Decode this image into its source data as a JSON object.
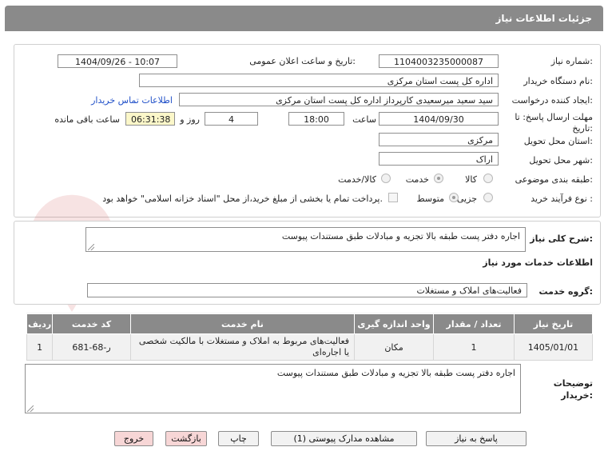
{
  "header": {
    "title": "جزئیات اطلاعات نیاز"
  },
  "form": {
    "need_number": {
      "label": "شماره نیاز:",
      "value": "1104003235000087"
    },
    "announce": {
      "label": "تاریخ و ساعت اعلان عمومی:",
      "value": "1404/09/26 - 10:07"
    },
    "buyer_org": {
      "label": "نام دستگاه خریدار:",
      "value": "اداره کل پست استان مرکزی"
    },
    "requester": {
      "label": "ایجاد کننده درخواست:",
      "value": "سید سعید میرسعیدی کارپرداز اداره کل پست استان مرکزی",
      "contact_link": "اطلاعات تماس خریدار"
    },
    "deadline": {
      "label_line1": "مهلت ارسال پاسخ: تا",
      "label_line2": "تاریخ:",
      "date": "1404/09/30",
      "time_label": "ساعت",
      "time": "18:00",
      "days": "4",
      "days_label": "روز و",
      "remaining": "06:31:38",
      "remaining_label": "ساعت باقی مانده"
    },
    "province": {
      "label": "استان محل تحویل:",
      "value": "مرکزی"
    },
    "city": {
      "label": "شهر محل تحویل:",
      "value": "اراک"
    },
    "category": {
      "label": "طبقه بندی موضوعی:",
      "options": [
        "کالا",
        "خدمت",
        "کالا/خدمت"
      ],
      "selected": "خدمت"
    },
    "purchase_type": {
      "label": "نوع فرآیند خرید :",
      "options": [
        "جزیی",
        "متوسط"
      ],
      "selected": "متوسط",
      "note": "پرداخت تمام یا بخشی از مبلغ خرید،از محل \"اسناد خزانه اسلامی\" خواهد بود."
    }
  },
  "description": {
    "label": "شرح کلی نیاز:",
    "value": "اجاره دفتر پست طبقه بالا تجزیه و مبادلات طبق مستندات پیوست"
  },
  "services": {
    "section_title": "اطلاعات خدمات مورد نیاز",
    "group_label": "گروه خدمت:",
    "group_value": "فعالیت‌های  املاک و مستغلات",
    "columns": [
      "ردیف",
      "کد خدمت",
      "نام خدمت",
      "واحد اندازه گیری",
      "تعداد / مقدار",
      "تاریخ نیاز"
    ],
    "rows": [
      {
        "row": "1",
        "code": "ر-68-681",
        "name": "فعالیت‌های مربوط به املاک و مستغلات با مالکیت شخصی یا اجاره‌ای",
        "unit": "مکان",
        "qty": "1",
        "date": "1405/01/01"
      }
    ]
  },
  "buyer_notes": {
    "label_line1": "توضیحات",
    "label_line2": "خریدار:",
    "value": "اجاره دفتر پست طبقه بالا تجزیه و مبادلات طبق مستندات پیوست"
  },
  "buttons": {
    "respond": "پاسخ به نیاز",
    "view_docs": "مشاهده مدارک پیوستی (1)",
    "print": "چاپ",
    "back": "بازگشت",
    "exit": "خروج"
  },
  "watermark": {
    "text": "AriaTender.neT"
  }
}
